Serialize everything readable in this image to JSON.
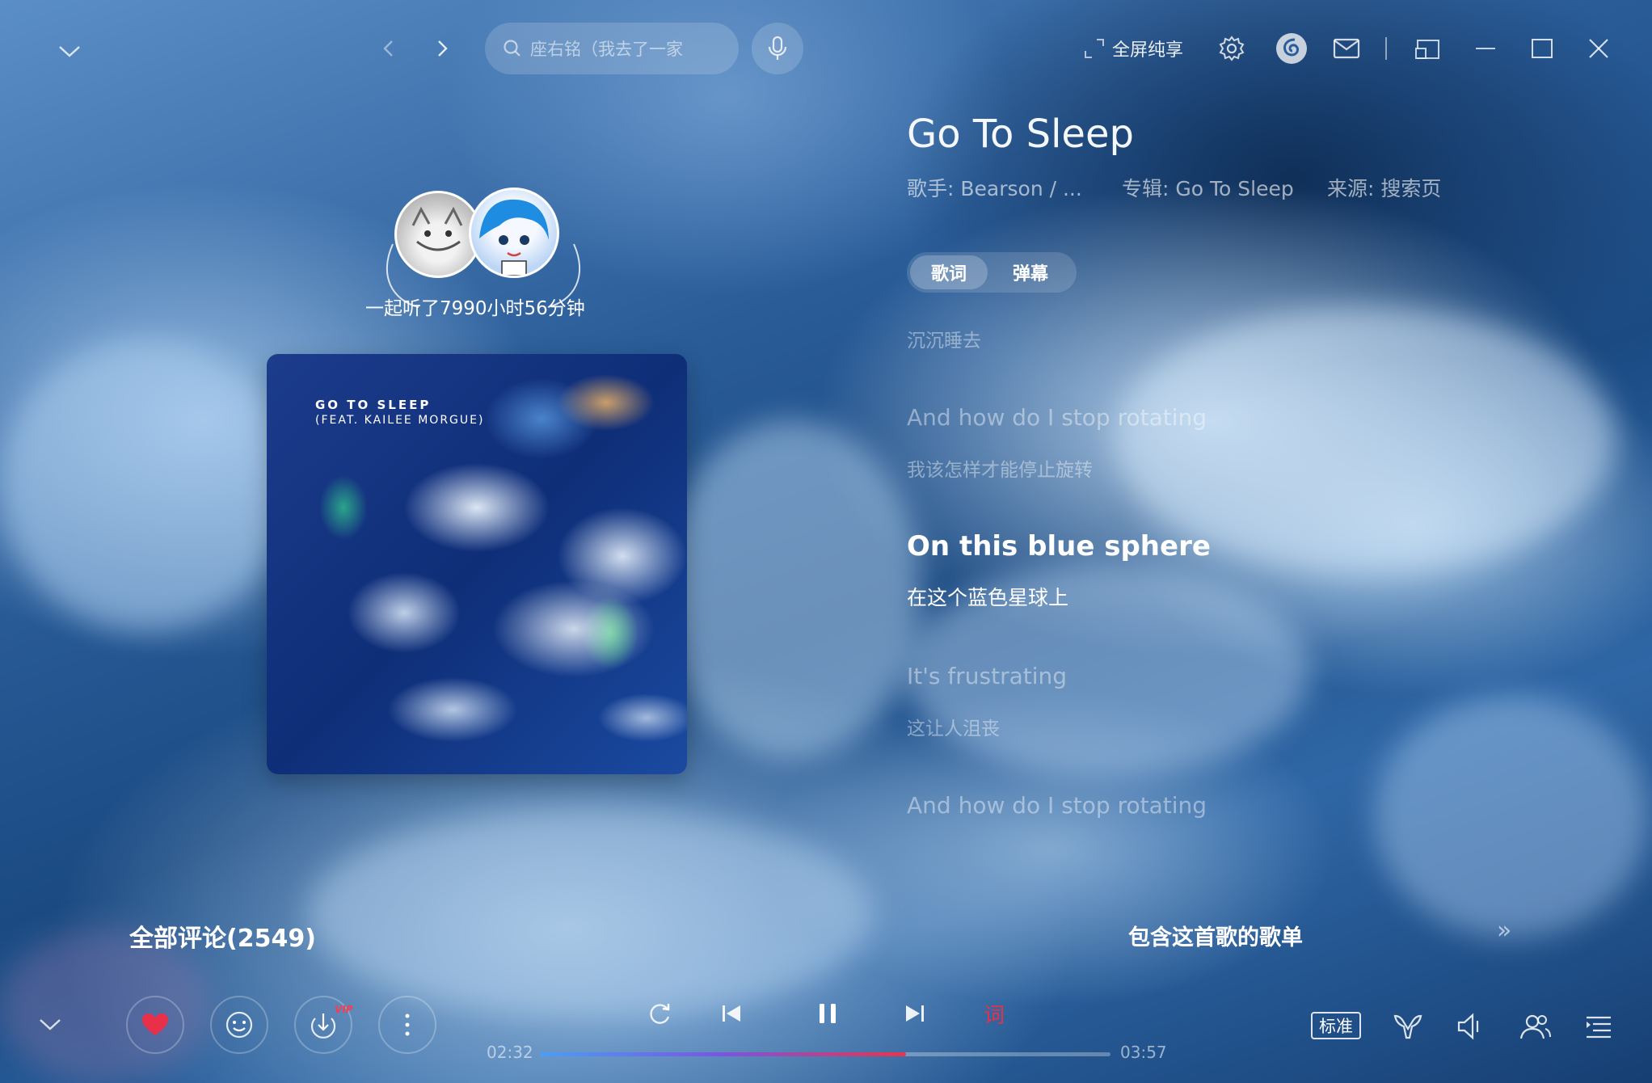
{
  "header": {
    "search_placeholder": "座右铭（我去了一家",
    "fullscreen_label": "全屏纯享"
  },
  "song": {
    "title": "Go To Sleep",
    "singer": "歌手: Bearson / ...",
    "album": "专辑: Go To Sleep",
    "source": "来源: 搜索页"
  },
  "tabs": [
    {
      "label": "歌词",
      "active": true
    },
    {
      "label": "弹幕",
      "active": false
    }
  ],
  "together": "一起听了7990小时56分钟",
  "cover": {
    "line1": "GO TO SLEEP",
    "line2": "(FEAT. KAILEE MORGUE)"
  },
  "lyrics": {
    "l0_cn": "沉沉睡去",
    "l1_en": "And how do I stop rotating",
    "l1_cn": "我该怎样才能停止旋转",
    "l2_en": "On this blue sphere",
    "l2_cn": "在这个蓝色星球上",
    "l3_en": "It's frustrating",
    "l3_cn": "这让人沮丧",
    "l4_en": "And how do I stop rotating"
  },
  "sections": {
    "comments": "全部评论(2549)",
    "playlists": "包含这首歌的歌单",
    "more": "»"
  },
  "player": {
    "elapsed": "02:32",
    "duration": "03:57",
    "progress": 0.642,
    "vip_badge": "VIP",
    "lyric_toggle": "词",
    "quality": "标准"
  },
  "colors": {
    "liked_heart": "#e8304a",
    "progress_start": "#4a9ef5",
    "progress_end": "#e6354d"
  }
}
